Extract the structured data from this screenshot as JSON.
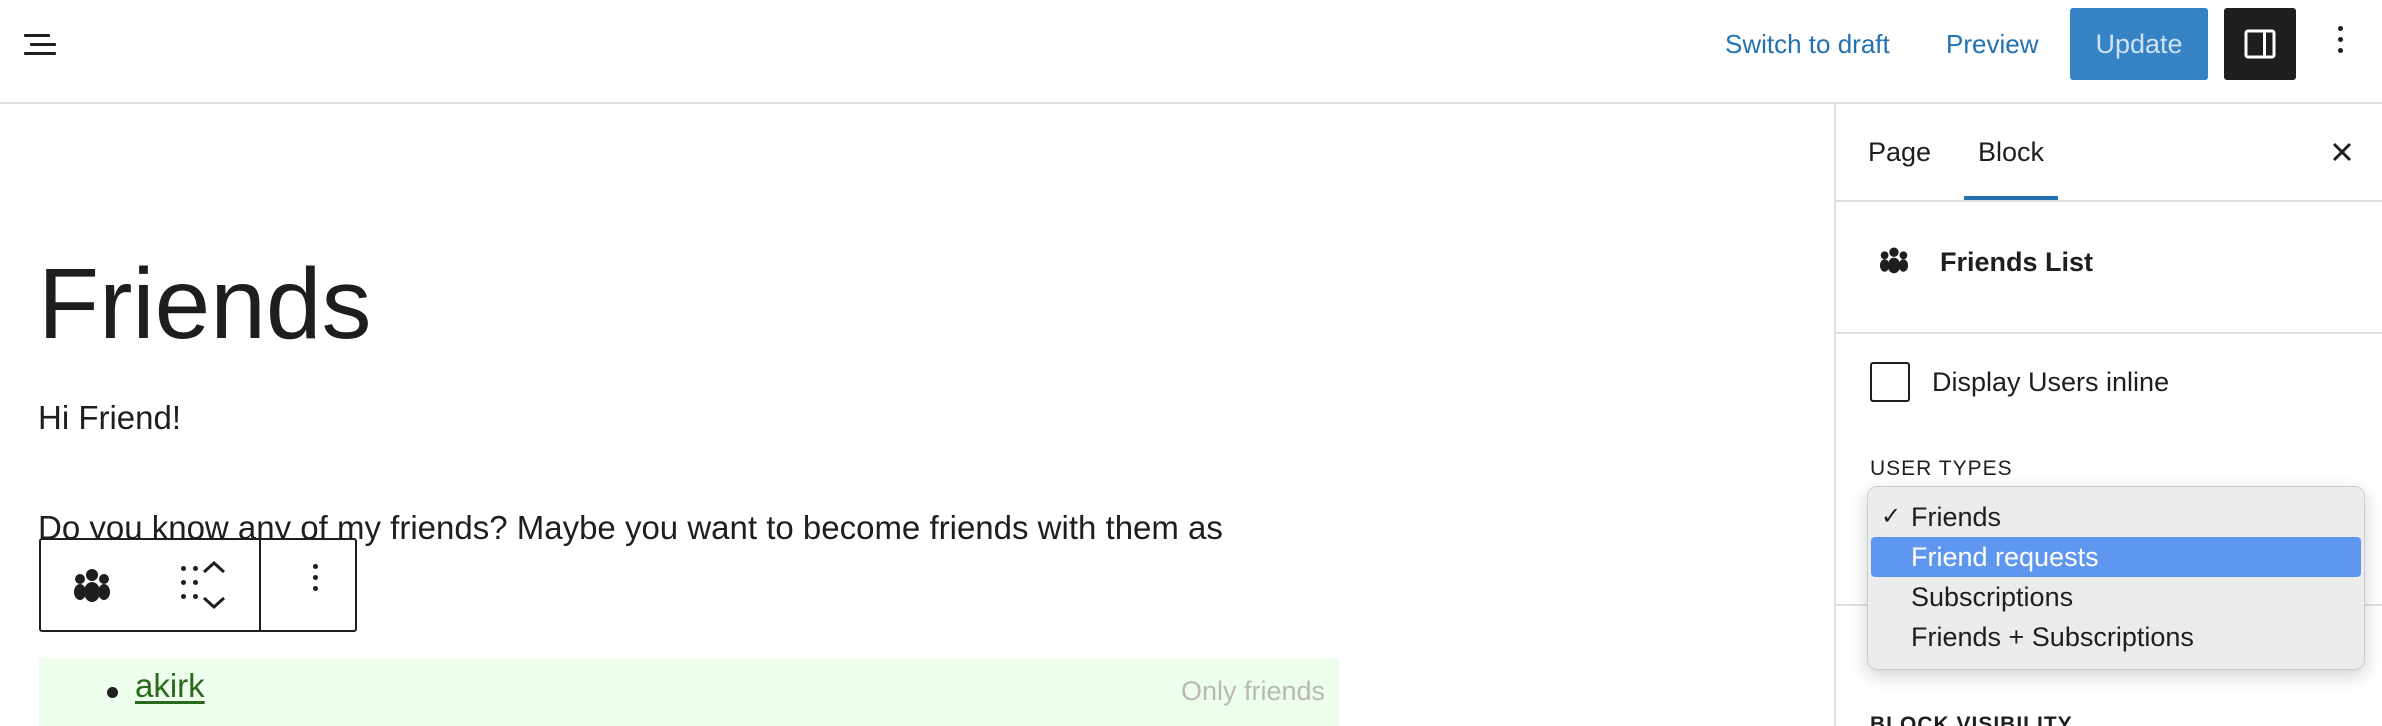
{
  "header": {
    "switch_label": "Switch to draft",
    "preview_label": "Preview",
    "update_label": "Update"
  },
  "editor": {
    "title": "Friends",
    "paragraph1": "Hi Friend!",
    "paragraph2": "Do you know any of my friends? Maybe you want to become friends with them as",
    "friends_list": [
      {
        "name": "akirk",
        "visibility": "Only friends"
      }
    ]
  },
  "sidebar": {
    "tabs": [
      {
        "label": "Page",
        "active": false
      },
      {
        "label": "Block",
        "active": true
      }
    ],
    "block_name": "Friends List",
    "display_inline_label": "Display Users inline",
    "display_inline_checked": false,
    "user_types_label": "USER TYPES",
    "dropdown_options": [
      {
        "label": "Friends",
        "selected": true,
        "highlighted": false
      },
      {
        "label": "Friend requests",
        "selected": false,
        "highlighted": true
      },
      {
        "label": "Subscriptions",
        "selected": false,
        "highlighted": false
      },
      {
        "label": "Friends + Subscriptions",
        "selected": false,
        "highlighted": false
      }
    ],
    "partial_section_label": "BLOCK VISIBILITY"
  },
  "colors": {
    "link": "#2271b1",
    "update_button": "#3582c4",
    "option_highlight": "#5f96f0",
    "list_background": "#eefeec"
  }
}
